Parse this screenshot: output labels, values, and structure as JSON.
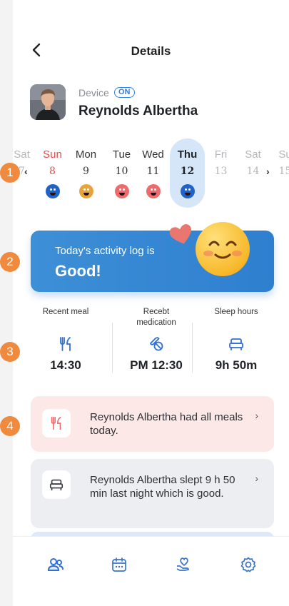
{
  "header": {
    "title": "Details"
  },
  "profile": {
    "device_label": "Device",
    "device_status": "ON",
    "name": "Reynolds Albertha"
  },
  "calendar": {
    "prev_arrow": "‹",
    "next_arrow": "›",
    "days": [
      {
        "name": "Sat",
        "num": "7",
        "mood": "none",
        "style": "muted"
      },
      {
        "name": "Sun",
        "num": "8",
        "mood": "blue",
        "style": "sunday"
      },
      {
        "name": "Mon",
        "num": "9",
        "mood": "orange",
        "style": "normal"
      },
      {
        "name": "Tue",
        "num": "10",
        "mood": "red",
        "style": "normal"
      },
      {
        "name": "Wed",
        "num": "11",
        "mood": "red",
        "style": "normal"
      },
      {
        "name": "Thu",
        "num": "12",
        "mood": "blue",
        "style": "today"
      },
      {
        "name": "Fri",
        "num": "13",
        "mood": "none",
        "style": "future"
      },
      {
        "name": "Sat",
        "num": "14",
        "mood": "none",
        "style": "future"
      },
      {
        "name": "Su",
        "num": "15",
        "mood": "none",
        "style": "future"
      }
    ],
    "mood_colors": {
      "blue": "#1f63c9",
      "orange": "#e8a43b",
      "red": "#ef6b6b"
    }
  },
  "step_badges": [
    "1",
    "2",
    "3",
    "4"
  ],
  "banner": {
    "subtitle": "Today's activity log is",
    "status": "Good!"
  },
  "stats": [
    {
      "label": "Recent meal",
      "value": "14:30",
      "icon": "utensils-icon"
    },
    {
      "label": "Recebt medication",
      "value": "PM 12:30",
      "icon": "pill-icon"
    },
    {
      "label": "Sleep hours",
      "value": "9h 50m",
      "icon": "bed-icon"
    }
  ],
  "cards": [
    {
      "text": "Reynolds Albertha had all meals today.",
      "icon": "utensils-icon",
      "bg": "#fde8e8"
    },
    {
      "text": "Reynolds Albertha slept 9 h 50 min last night which is good.",
      "icon": "bed-icon",
      "bg": "#eceef1"
    }
  ],
  "tabs": [
    {
      "name": "tab-users",
      "icon": "users-icon",
      "active": true
    },
    {
      "name": "tab-calendar",
      "icon": "calendar-icon",
      "active": false
    },
    {
      "name": "tab-care",
      "icon": "heart-hand-icon",
      "active": false
    },
    {
      "name": "tab-settings",
      "icon": "gear-icon",
      "active": false
    }
  ],
  "colors": {
    "accent": "#2f7fe0",
    "badge": "#f08a3e",
    "sunday": "#e24a4a"
  }
}
